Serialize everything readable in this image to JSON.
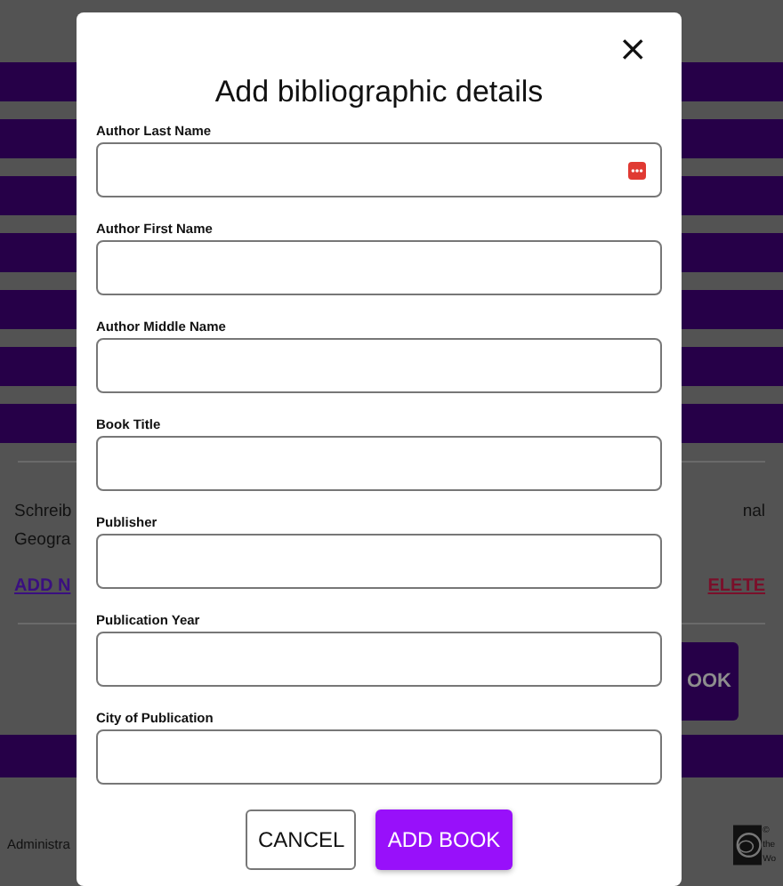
{
  "background_page": {
    "text_left": [
      "Schreib",
      "Geogra"
    ],
    "text_right": "nal",
    "link_left": "ADD N",
    "link_right": "ELETE",
    "button": "OOK",
    "footer_text": "Administra",
    "footer_note": [
      "©",
      "the",
      "Wo"
    ]
  },
  "dialog": {
    "title": "Add bibliographic details",
    "close": "×",
    "fields": [
      {
        "label": "Author Last Name",
        "autofill_icon": true
      },
      {
        "label": "Author First Name",
        "autofill_icon": false
      },
      {
        "label": "Author Middle Name",
        "autofill_icon": false
      },
      {
        "label": "Book Title",
        "autofill_icon": false
      },
      {
        "label": "Publisher",
        "autofill_icon": false
      },
      {
        "label": "Publication Year",
        "autofill_icon": false
      },
      {
        "label": "City of Publication",
        "autofill_icon": false
      }
    ],
    "buttons": [
      {
        "label": "CANCEL",
        "kind": "secondary"
      },
      {
        "label": "ADD BOOK",
        "kind": "primary"
      }
    ]
  }
}
